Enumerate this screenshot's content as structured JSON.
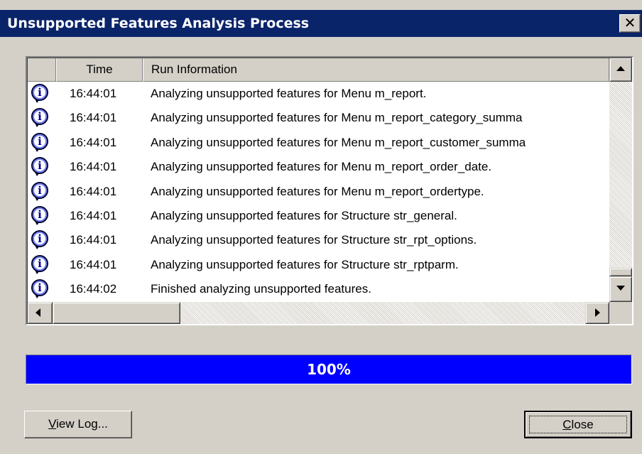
{
  "window": {
    "title": "Unsupported Features Analysis Process",
    "close_glyph": "✕"
  },
  "list": {
    "columns": {
      "icon": "",
      "time": "Time",
      "info": "Run Information"
    },
    "icon_name": "info-icon",
    "rows": [
      {
        "time": "16:44:01",
        "info": "Analyzing unsupported features for Menu m_report."
      },
      {
        "time": "16:44:01",
        "info": "Analyzing unsupported features for Menu m_report_category_summa"
      },
      {
        "time": "16:44:01",
        "info": "Analyzing unsupported features for Menu m_report_customer_summa"
      },
      {
        "time": "16:44:01",
        "info": "Analyzing unsupported features for Menu m_report_order_date."
      },
      {
        "time": "16:44:01",
        "info": "Analyzing unsupported features for Menu m_report_ordertype."
      },
      {
        "time": "16:44:01",
        "info": "Analyzing unsupported features for Structure str_general."
      },
      {
        "time": "16:44:01",
        "info": "Analyzing unsupported features for Structure str_rpt_options."
      },
      {
        "time": "16:44:01",
        "info": "Analyzing unsupported features for Structure str_rptparm."
      },
      {
        "time": "16:44:02",
        "info": "Finished analyzing unsupported features."
      }
    ]
  },
  "progress": {
    "percent": 100,
    "label": "100%",
    "color": "#0000ff"
  },
  "buttons": {
    "view_log": {
      "mnemonic": "V",
      "rest": "iew Log..."
    },
    "close": {
      "mnemonic": "C",
      "rest": "lose"
    }
  },
  "colors": {
    "titlebar": "#0a246a",
    "dialog": "#d4d0c8",
    "progress_fill": "#0000ff"
  }
}
